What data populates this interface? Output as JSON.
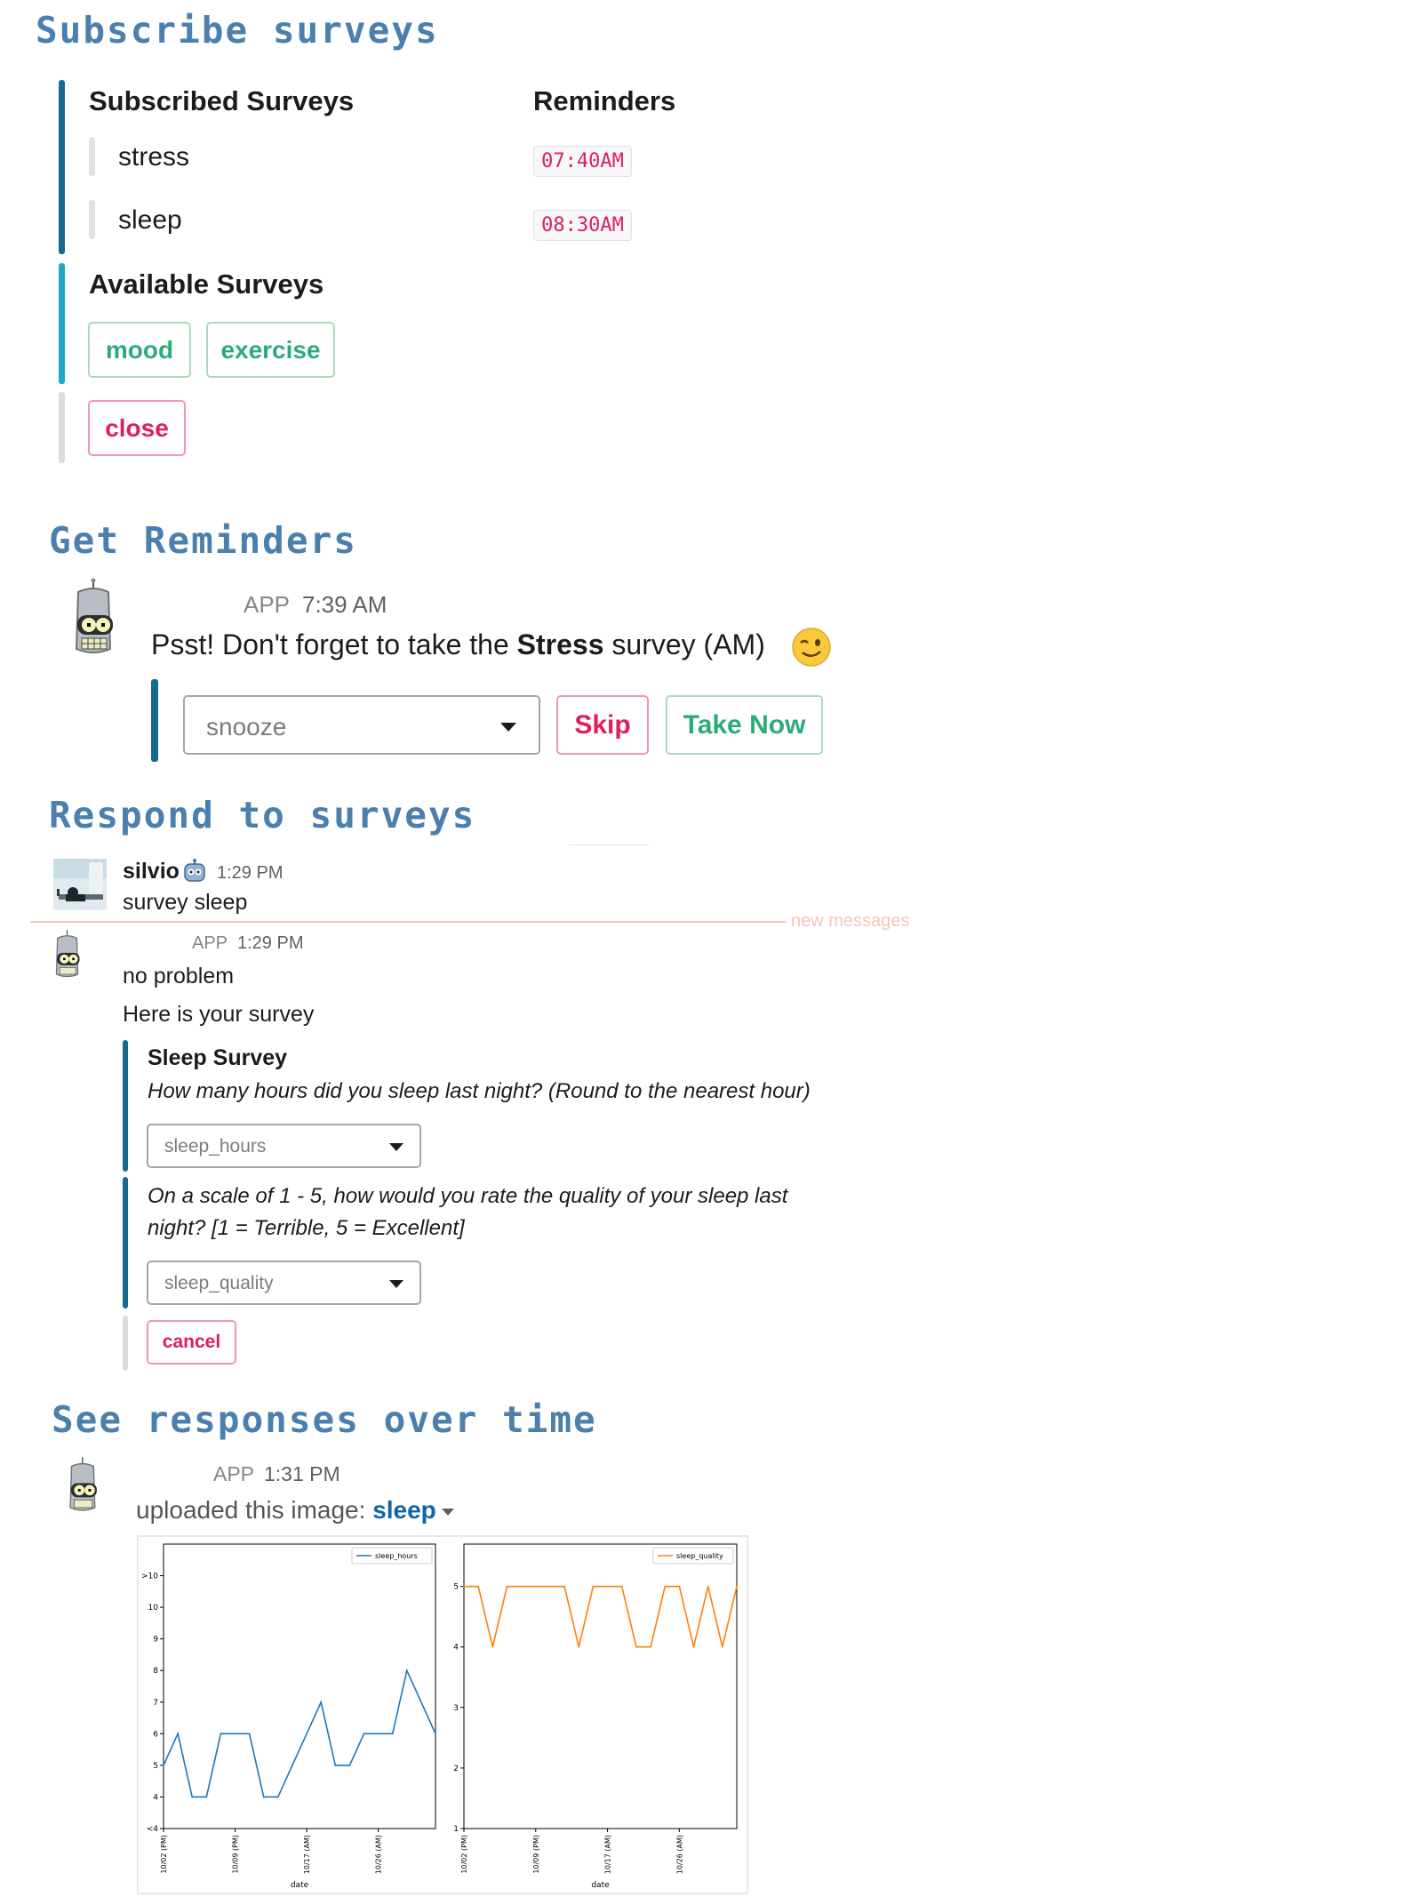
{
  "sections": {
    "subscribe": "Subscribe surveys",
    "reminders": "Get Reminders",
    "respond": "Respond to surveys",
    "responses": "See responses over time"
  },
  "subscribe_panel": {
    "subscribed_header": "Subscribed Surveys",
    "reminders_header": "Reminders",
    "subscribed": [
      {
        "name": "stress",
        "reminder": "07:40AM"
      },
      {
        "name": "sleep",
        "reminder": "08:30AM"
      }
    ],
    "available_header": "Available Surveys",
    "available": [
      "mood",
      "exercise"
    ],
    "close_label": "close",
    "colors": {
      "subscribed_bar": "#166a8f",
      "available_bar": "#1ea7c4",
      "close_bar": "#dddddd"
    }
  },
  "reminder_msg": {
    "app_badge": "APP",
    "time": "7:39 AM",
    "text_before": "Psst! Don't forget to take the ",
    "text_bold": "Stress",
    "text_after": " survey (AM)",
    "emoji": "wink-emoji",
    "snooze_placeholder": "snooze",
    "skip_label": "Skip",
    "take_now_label": "Take Now"
  },
  "respond_conv": {
    "user_name": "silvio",
    "user_badge_icon": "robot-face-icon",
    "user_time": "1:29 PM",
    "user_text": "survey sleep",
    "divider_label": "new messages",
    "app_badge": "APP",
    "app_time": "1:29 PM",
    "line1": "no problem",
    "line2": "Here is your survey",
    "survey_title": "Sleep Survey",
    "q1": "How many hours did you sleep last night? (Round to the nearest hour)",
    "q1_placeholder": "sleep_hours",
    "q2_line1": "On a scale of 1 - 5, how would you rate the quality of your sleep last",
    "q2_line2": "night? [1 = Terrible, 5 = Excellent]",
    "q2_placeholder": "sleep_quality",
    "cancel_label": "cancel"
  },
  "upload_msg": {
    "app_badge": "APP",
    "time": "1:31 PM",
    "text": "uploaded this image: ",
    "file_link": "sleep"
  },
  "chart_data": [
    {
      "type": "line",
      "series": [
        {
          "name": "sleep_hours",
          "color": "#1f77b4",
          "values": [
            5,
            6,
            4,
            4,
            6,
            6,
            4,
            4,
            5,
            6,
            7,
            5,
            5,
            6,
            6,
            8,
            6
          ]
        }
      ],
      "x": [
        0,
        1,
        2,
        3,
        4,
        6,
        7,
        8,
        9,
        10,
        11,
        12,
        13,
        14,
        16,
        17,
        19
      ],
      "x_range": [
        0,
        19
      ],
      "xlabel": "date",
      "x_ticks": [
        {
          "at": 0,
          "label": "10/02 (PM)"
        },
        {
          "at": 5,
          "label": "10/09 (PM)"
        },
        {
          "at": 10,
          "label": "10/17 (AM)"
        },
        {
          "at": 15,
          "label": "10/26 (AM)"
        }
      ],
      "y_ticks": [
        {
          "at": 3,
          "label": "<4"
        },
        {
          "at": 4,
          "label": "4"
        },
        {
          "at": 5,
          "label": "5"
        },
        {
          "at": 6,
          "label": "6"
        },
        {
          "at": 7,
          "label": "7"
        },
        {
          "at": 8,
          "label": "8"
        },
        {
          "at": 9,
          "label": "9"
        },
        {
          "at": 10,
          "label": "10"
        },
        {
          "at": 11,
          "label": ">10"
        }
      ],
      "ylim": [
        3,
        12
      ],
      "legend": "top-right",
      "grid": false
    },
    {
      "type": "line",
      "series": [
        {
          "name": "sleep_quality",
          "color": "#ff7f0e",
          "values": [
            5,
            5,
            4,
            5,
            5,
            5,
            5,
            5,
            4,
            5,
            5,
            5,
            4,
            4,
            5,
            5,
            4,
            5,
            4,
            5
          ]
        }
      ],
      "x": [
        0,
        1,
        2,
        3,
        4,
        5,
        6,
        7,
        8,
        9,
        10,
        11,
        12,
        13,
        14,
        15,
        16,
        17,
        18,
        19
      ],
      "x_range": [
        0,
        19
      ],
      "xlabel": "date",
      "x_ticks": [
        {
          "at": 0,
          "label": "10/02 (PM)"
        },
        {
          "at": 5,
          "label": "10/09 (PM)"
        },
        {
          "at": 10,
          "label": "10/17 (AM)"
        },
        {
          "at": 15,
          "label": "10/26 (AM)"
        }
      ],
      "y_ticks": [
        {
          "at": 1,
          "label": "1"
        },
        {
          "at": 2,
          "label": "2"
        },
        {
          "at": 3,
          "label": "3"
        },
        {
          "at": 4,
          "label": "4"
        },
        {
          "at": 5,
          "label": "5"
        }
      ],
      "ylim": [
        1,
        5.7
      ],
      "legend": "top-right",
      "grid": false
    }
  ]
}
